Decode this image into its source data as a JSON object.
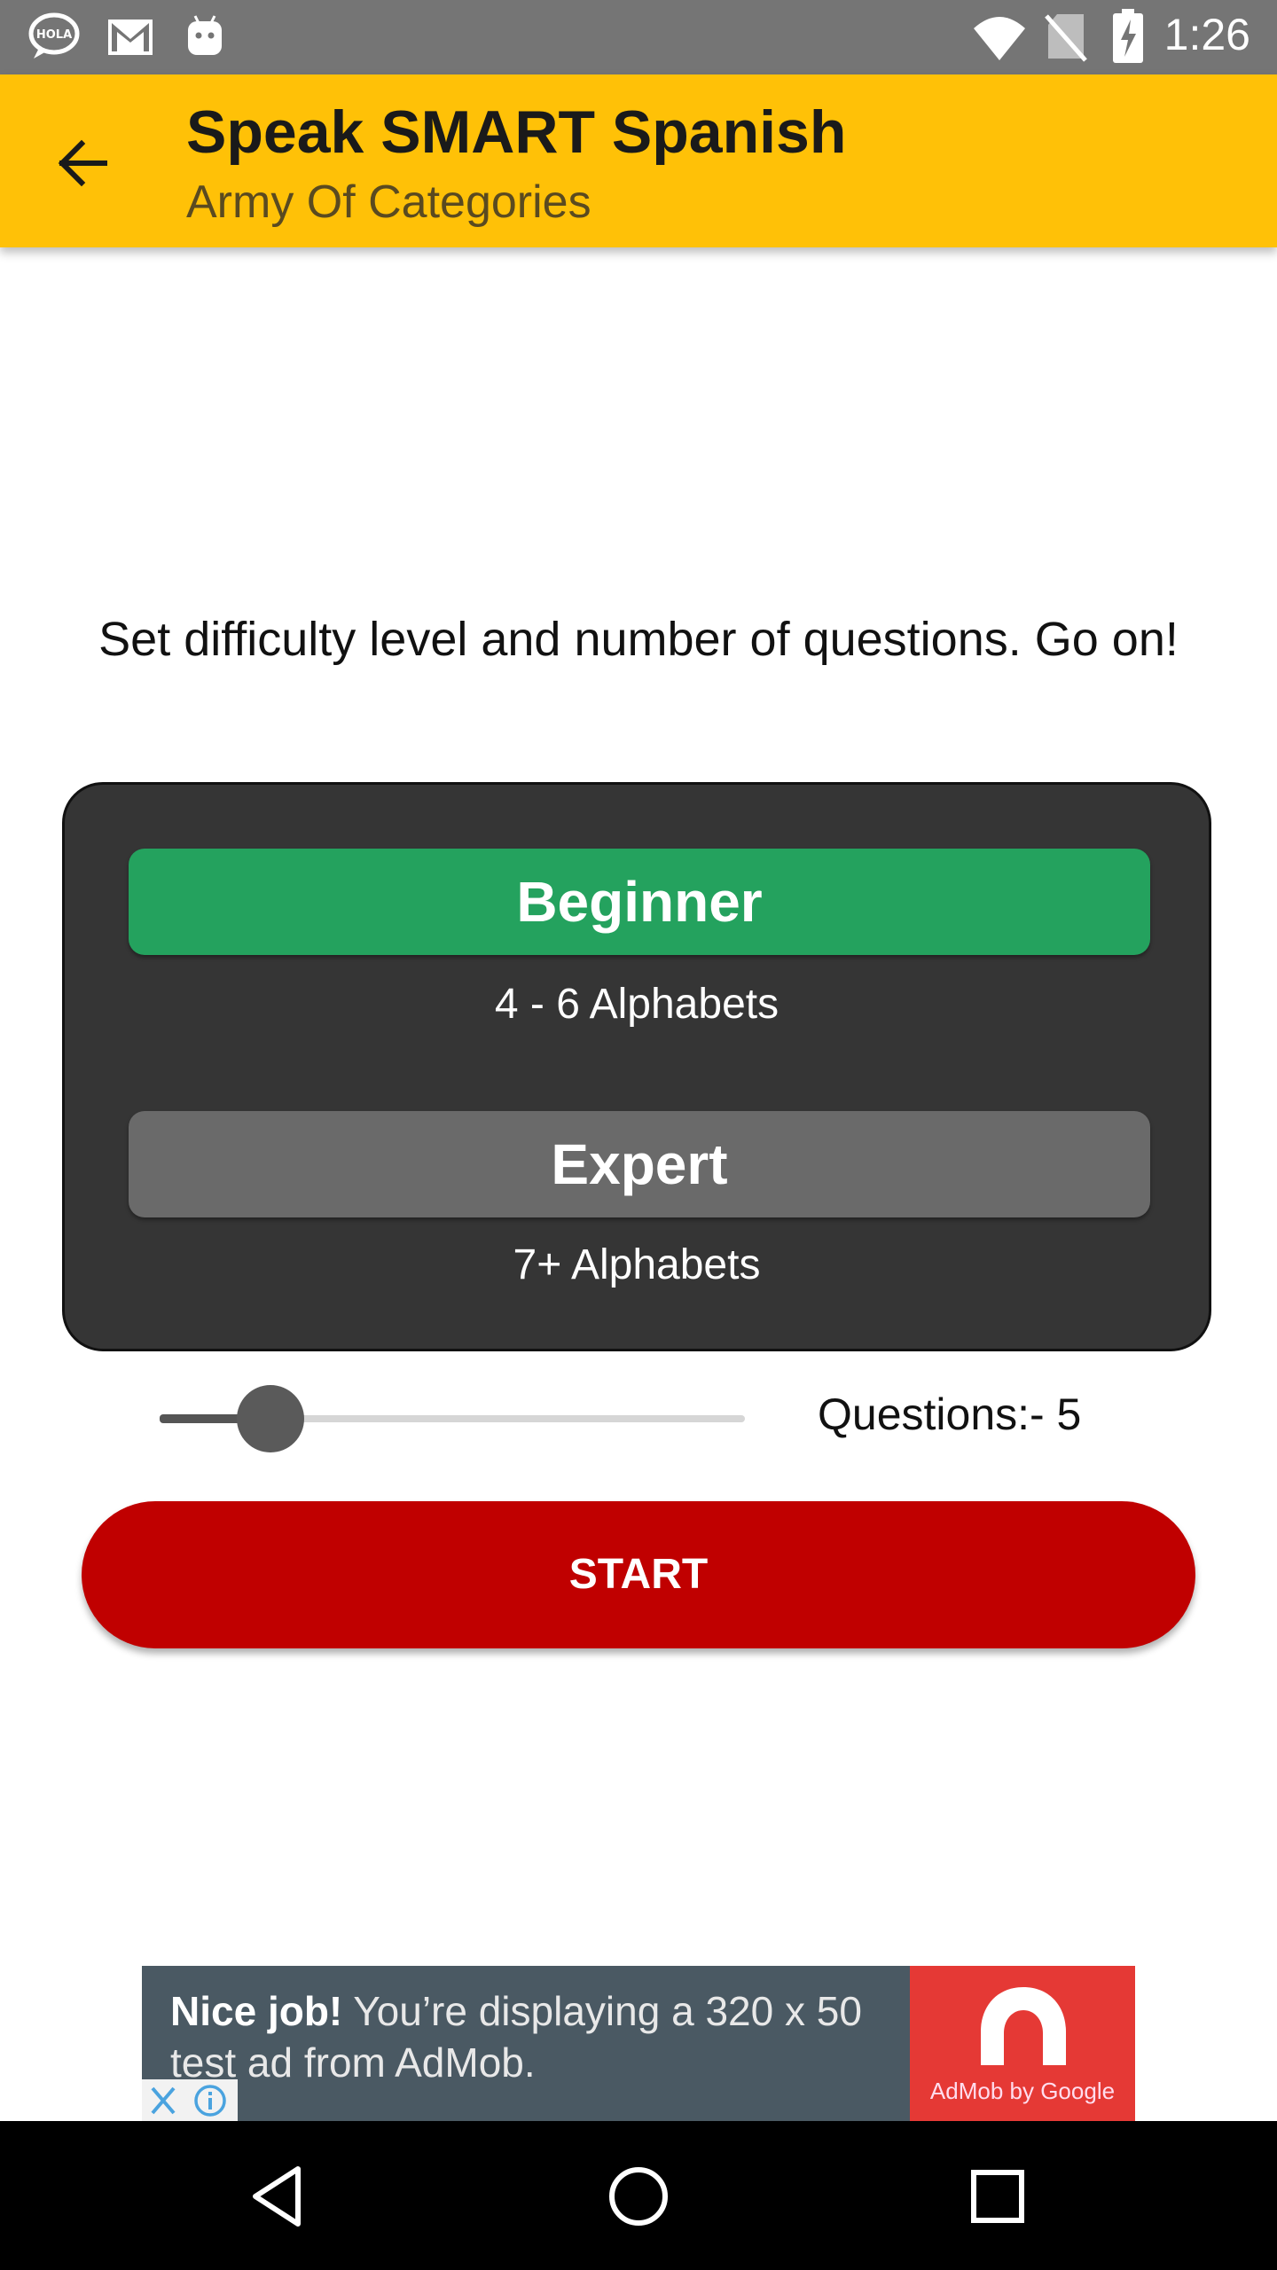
{
  "status_bar": {
    "time": "1:26",
    "icons": [
      "hola-icon",
      "gmail-icon",
      "android-icon",
      "wifi-icon",
      "no-sim-icon",
      "battery-icon"
    ]
  },
  "app_bar": {
    "title": "Speak SMART Spanish",
    "subtitle": "Army Of Categories",
    "color": "#FFC107"
  },
  "instructions": "Set difficulty level and number of questions. Go on!",
  "difficulty": {
    "beginner_label": "Beginner",
    "beginner_desc": "4 - 6 Alphabets",
    "beginner_color": "#24A25E",
    "expert_label": "Expert",
    "expert_desc": "7+ Alphabets",
    "expert_color": "#6a6a6a",
    "selected": "Beginner"
  },
  "questions": {
    "label": "Questions:- 5",
    "slider_fraction": 0.19
  },
  "start_label": "START",
  "ad": {
    "headline": "Nice job!",
    "body": " You’re displaying a 320 x 50 test ad from AdMob.",
    "brand": "AdMob by Google"
  },
  "nav": {
    "icons": [
      "back-triangle-icon",
      "home-circle-icon",
      "recents-square-icon"
    ]
  }
}
